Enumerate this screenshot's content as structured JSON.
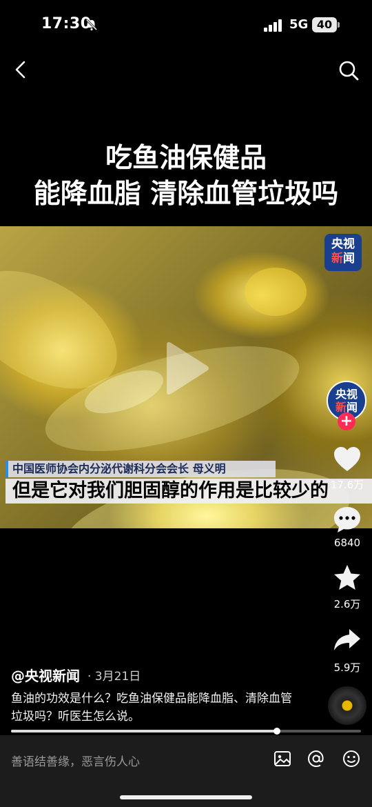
{
  "status_bar": {
    "time": "17:30",
    "network": "5G",
    "battery": "40"
  },
  "video": {
    "title_line1": "吃鱼油保健品",
    "title_line2": "能降血脂 清除血管垃圾吗",
    "logo_line1": "央视",
    "logo_line2a": "新",
    "logo_line2b": "闻",
    "speaker": "中国医师协会内分泌代谢科分会会长 母义明",
    "subtitle": "但是它对我们胆固醇的作用是比较少的",
    "progress": 0.76
  },
  "rail": {
    "avatar_line1": "央视",
    "avatar_line2a": "新",
    "avatar_line2b": "闻",
    "follow": "+",
    "likes": "17.6万",
    "comments": "6840",
    "favorites": "2.6万",
    "shares": "5.9万"
  },
  "post": {
    "author": "@央视新闻",
    "date": "· 3月21日",
    "description": "鱼油的功效是什么？吃鱼油保健品能降血脂、清除血管垃圾吗？听医生怎么说。"
  },
  "comment_bar": {
    "placeholder": "善语结善缘，恶言伤人心"
  },
  "icons": [
    "bell-off-icon",
    "signal-icon",
    "back-icon",
    "search-icon",
    "play-icon",
    "heart-icon",
    "comment-icon",
    "star-icon",
    "share-icon",
    "image-icon",
    "at-icon",
    "emoji-icon"
  ]
}
